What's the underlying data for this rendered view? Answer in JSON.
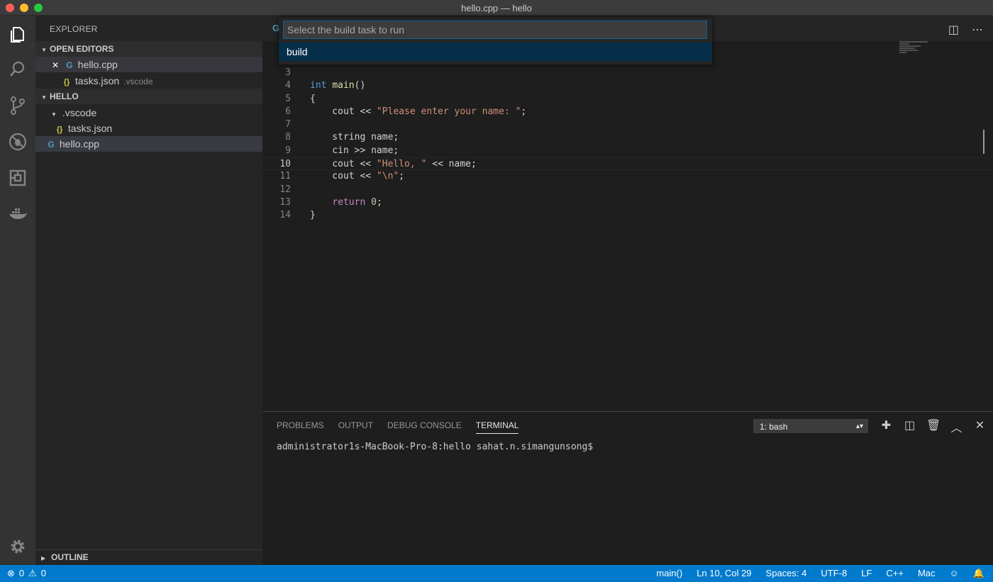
{
  "window": {
    "title": "hello.cpp — hello"
  },
  "sidebar": {
    "title": "EXPLORER",
    "open_editors": {
      "label": "OPEN EDITORS",
      "items": [
        {
          "name": "hello.cpp"
        },
        {
          "name": "tasks.json",
          "folder": ".vscode"
        }
      ]
    },
    "workspace": {
      "label": "HELLO",
      "items": [
        {
          "name": ".vscode"
        },
        {
          "name": "tasks.json"
        },
        {
          "name": "hello.cpp"
        }
      ]
    },
    "outline_label": "OUTLINE"
  },
  "quick_input": {
    "placeholder": "Select the build task to run",
    "items": [
      "build"
    ]
  },
  "editor": {
    "tab_fragment": "G",
    "lines": [
      {
        "num": "3"
      },
      {
        "num": "4"
      },
      {
        "num": "5"
      },
      {
        "num": "6"
      },
      {
        "num": "7"
      },
      {
        "num": "8"
      },
      {
        "num": "9"
      },
      {
        "num": "10"
      },
      {
        "num": "11"
      },
      {
        "num": "12"
      },
      {
        "num": "13"
      },
      {
        "num": "14"
      }
    ],
    "code": {
      "l4_kw": "int",
      "l4_fn": "main",
      "l4_rest": "()",
      "l5": "{",
      "l6_pre": "    cout << ",
      "l6_str": "\"Please enter your name: \"",
      "l6_post": ";",
      "l8": "    string name;",
      "l9": "    cin >> name;",
      "l10_pre": "    cout << ",
      "l10_str": "\"Hello, \"",
      "l10_post": " << name;",
      "l11_pre": "    cout << ",
      "l11_str": "\"\\n\"",
      "l11_post": ";",
      "l13_kw": "return",
      "l13_num": "0",
      "l13_post": ";",
      "l14": "}"
    }
  },
  "panel": {
    "tabs": [
      "PROBLEMS",
      "OUTPUT",
      "DEBUG CONSOLE",
      "TERMINAL"
    ],
    "terminal_select": "1: bash",
    "terminal_prompt": "administrator1s-MacBook-Pro-8:hello sahat.n.simangunsong$"
  },
  "statusbar": {
    "errors": "0",
    "warnings": "0",
    "scope": "main()",
    "position": "Ln 10, Col 29",
    "spaces": "Spaces: 4",
    "encoding": "UTF-8",
    "eol": "LF",
    "language": "C++",
    "platform": "Mac"
  },
  "colors": {
    "accent": "#007acc",
    "selection": "#062f4a"
  }
}
